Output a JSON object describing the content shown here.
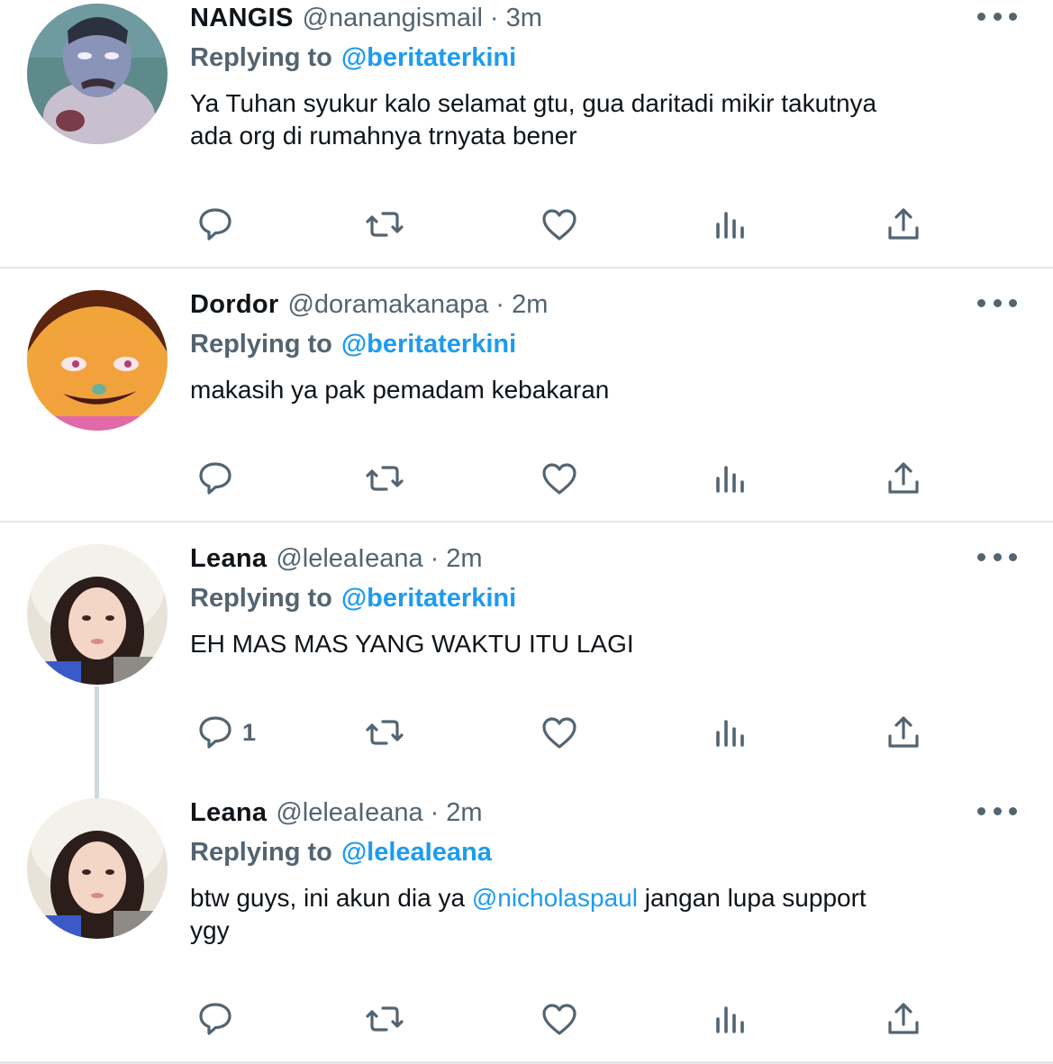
{
  "tweets": [
    {
      "name": "NANGIS",
      "handle": "@nanangismail",
      "separator": "·",
      "time": "3m",
      "replying_prefix": "Replying to",
      "replying_to": "@beritaterkini",
      "text_line1": "Ya Tuhan syukur kalo selamat gtu, gua daritadi mikir takutnya",
      "text_line2": "ada org di rumahnya trnyata bener",
      "reply_count": ""
    },
    {
      "name": "Dordor",
      "handle": "@doramakanapa",
      "separator": "·",
      "time": "2m",
      "replying_prefix": "Replying to",
      "replying_to": "@beritaterkini",
      "text_line1": "makasih ya pak pemadam kebakaran",
      "reply_count": ""
    },
    {
      "name": "Leana",
      "handle": "@leleaIeana",
      "separator": "·",
      "time": "2m",
      "replying_prefix": "Replying to",
      "replying_to": "@beritaterkini",
      "text_line1": "EH MAS MAS YANG WAKTU ITU LAGI",
      "reply_count": "1"
    },
    {
      "name": "Leana",
      "handle": "@leleaIeana",
      "separator": "·",
      "time": "2m",
      "replying_prefix": "Replying to",
      "replying_to": "@leleaIeana",
      "text_before": "btw guys, ini akun dia ya ",
      "text_mention": "@nicholaspaul",
      "text_after": " jangan lupa support",
      "text_line2": "ygy",
      "reply_count": ""
    }
  ],
  "icons": [
    "reply-icon",
    "retweet-icon",
    "like-icon",
    "analytics-icon",
    "share-icon",
    "more-icon"
  ],
  "colors": {
    "accent": "#1d9bf0",
    "secondary_text": "#536471",
    "divider": "#e3e6e9",
    "thread_line": "#cfd9de"
  }
}
